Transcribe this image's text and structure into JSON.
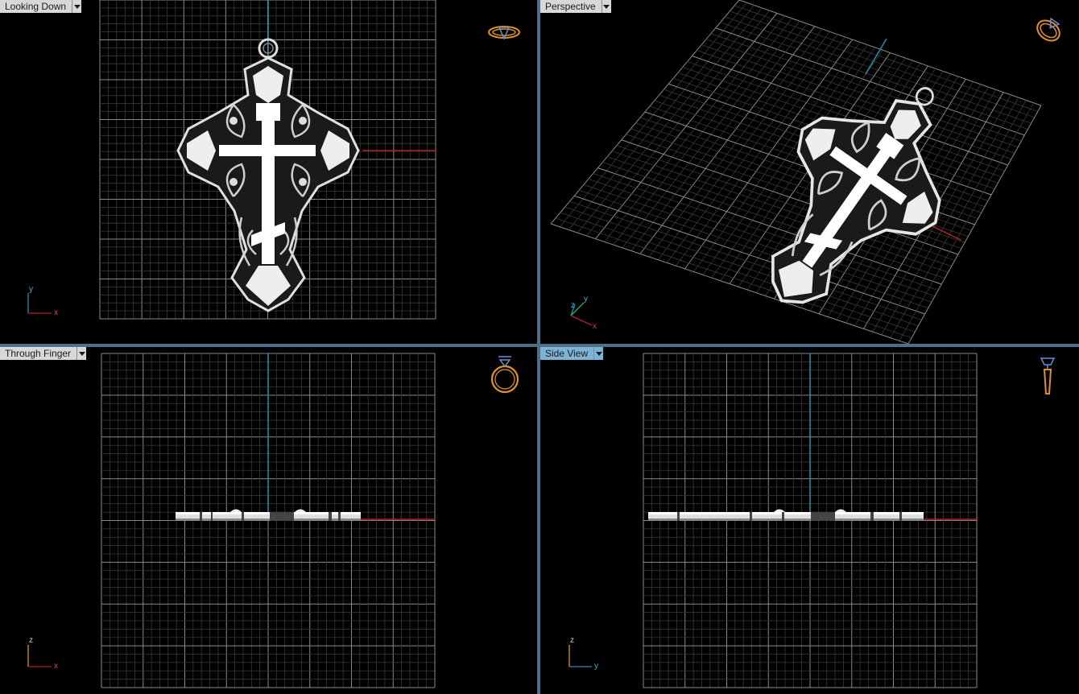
{
  "viewports": {
    "top": {
      "label": "Looking Down",
      "active": false,
      "axes": [
        "y",
        "x"
      ]
    },
    "persp": {
      "label": "Perspective",
      "active": false,
      "axes": [
        "z",
        "y",
        "x"
      ]
    },
    "front": {
      "label": "Through Finger",
      "active": false,
      "axes": [
        "z",
        "x"
      ]
    },
    "side": {
      "label": "Side View",
      "active": true,
      "axes": [
        "z",
        "y"
      ]
    }
  },
  "colors": {
    "grid_minor": "#3a3a3a",
    "grid_major": "#8a8a8a",
    "axis_x": "#b22222",
    "axis_y": "#2b8fa8",
    "ring_icon": "#e0922a",
    "gem_icon": "#6a8fd0",
    "model": "#e8e8e8"
  },
  "icons": {
    "top": "ring-top-icon",
    "persp": "ring-perspective-icon",
    "front": "ring-front-icon",
    "side": "ring-side-icon"
  }
}
